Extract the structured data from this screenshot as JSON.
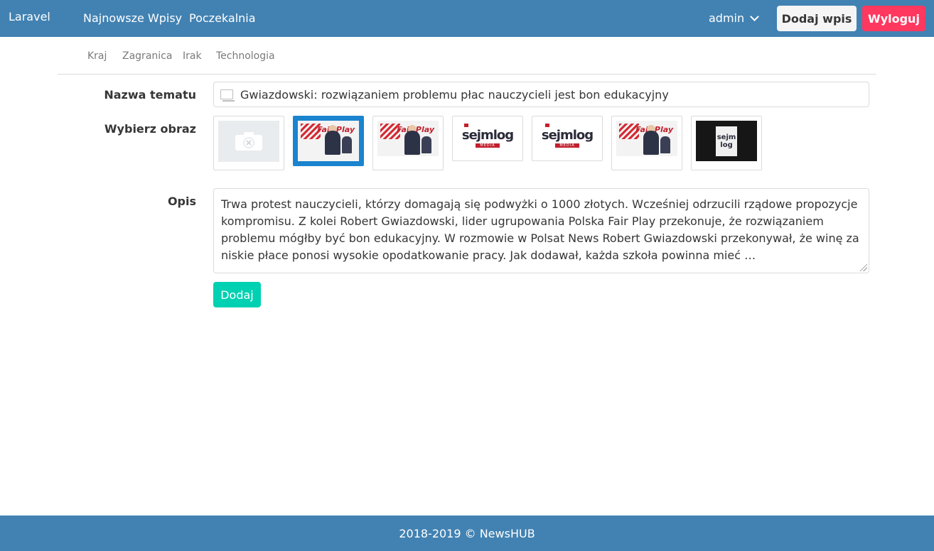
{
  "navbar": {
    "brand": "Laravel",
    "links": [
      "Najnowsze Wpisy",
      "Poczekalnia"
    ],
    "user": "admin",
    "add_post": "Dodaj wpis",
    "logout": "Wyloguj"
  },
  "categories": [
    "Kraj",
    "Zagranica",
    "Irak",
    "Technologia"
  ],
  "form": {
    "title_label": "Nazwa tematu",
    "title_value": "Gwiazdowski: rozwiązaniem problemu płac nauczycieli jest bon edukacyjny",
    "image_label": "Wybierz obraz",
    "images": [
      {
        "kind": "placeholder",
        "icon": "camera-off-icon"
      },
      {
        "kind": "fairplay",
        "selected": true,
        "brand": "Fair Play"
      },
      {
        "kind": "fairplay",
        "brand": "Fair Play"
      },
      {
        "kind": "sejmlog",
        "brand": "sejmlog",
        "sub": "MEDIA"
      },
      {
        "kind": "sejmlog",
        "brand": "sejmlog",
        "sub": "MEDIA"
      },
      {
        "kind": "fairplay",
        "brand": "Fair Play"
      },
      {
        "kind": "dark",
        "brand_line1": "sejm",
        "brand_line2": "log"
      }
    ],
    "description_label": "Opis",
    "description": "Trwa protest nauczycieli, którzy domagają się podwyżki o 1000 złotych. Wcześniej odrzucili rządowe propozycje kompromisu. Z kolei Robert Gwiazdowski, lider ugrupowania Polska Fair Play przekonuje, że rozwiązaniem problemu mógłby być bon edukacyjny. W rozmowie w Polsat News Robert Gwiazdowski przekonywał, że winę za niskie płace ponosi wysokie opodatkowanie pracy. Jak dodawał, każda szkoła powinna mieć …",
    "submit": "Dodaj"
  },
  "footer": "2018-2019 © NewsHUB"
}
